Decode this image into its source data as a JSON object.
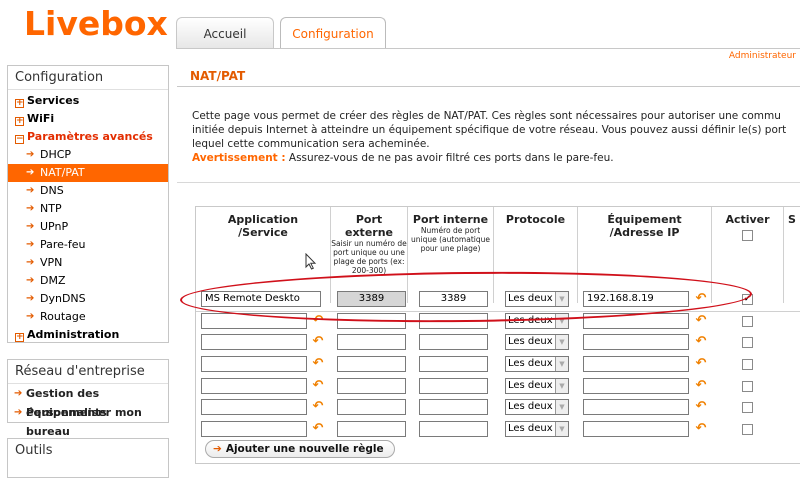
{
  "brand": {
    "logo": "Livebox"
  },
  "header": {
    "tabs": [
      {
        "label": "Accueil"
      },
      {
        "label": "Configuration"
      }
    ],
    "user_link": "Administrateur"
  },
  "sidebar": {
    "config_title": "Configuration",
    "items": [
      {
        "label": "Services"
      },
      {
        "label": "WiFi"
      },
      {
        "label": "Paramètres avancés"
      },
      {
        "label": "DHCP"
      },
      {
        "label": "NAT/PAT"
      },
      {
        "label": "DNS"
      },
      {
        "label": "NTP"
      },
      {
        "label": "UPnP"
      },
      {
        "label": "Pare-feu"
      },
      {
        "label": "VPN"
      },
      {
        "label": "DMZ"
      },
      {
        "label": "DynDNS"
      },
      {
        "label": "Routage"
      },
      {
        "label": "Administration"
      }
    ],
    "network_title": "Réseau d'entreprise",
    "network_items": [
      {
        "label": "Gestion des équipements"
      },
      {
        "label": "Personnaliser mon bureau"
      }
    ],
    "tools_title": "Outils"
  },
  "main": {
    "title": "NAT/PAT",
    "desc_line1": "Cette page vous permet de créer des règles de NAT/PAT. Ces règles sont nécessaires pour autoriser une commu",
    "desc_line2": "initiée depuis Internet à atteindre un équipement spécifique de votre réseau. Vous pouvez aussi définir le(s) port",
    "desc_line3": "lequel cette communication sera acheminée.",
    "warning_label": "Avertissement :",
    "warning_text": " Assurez-vous de ne pas avoir filtré ces ports dans le pare-feu."
  },
  "table": {
    "headers": {
      "app_line1": "Application",
      "app_line2": "/Service",
      "ext_line1": "Port",
      "ext_line2": "externe",
      "ext_hint": "Saisir un numéro de port unique ou une plage de ports (ex: 200-300)",
      "int_line1": "Port interne",
      "int_hint": "Numéro de port unique (automatique pour une plage)",
      "proto": "Protocole",
      "dev_line1": "Équipement",
      "dev_line2": "/Adresse IP",
      "act": "Activer",
      "s": "S"
    },
    "rows": [
      {
        "app": "MS Remote Deskto",
        "ext": "3389",
        "int": "3389",
        "proto": "Les deux",
        "ip": "192.168.8.19",
        "checked": true
      },
      {
        "app": "",
        "ext": "",
        "int": "",
        "proto": "Les deux",
        "ip": "",
        "checked": false
      },
      {
        "app": "",
        "ext": "",
        "int": "",
        "proto": "Les deux",
        "ip": "",
        "checked": false
      },
      {
        "app": "",
        "ext": "",
        "int": "",
        "proto": "Les deux",
        "ip": "",
        "checked": false
      },
      {
        "app": "",
        "ext": "",
        "int": "",
        "proto": "Les deux",
        "ip": "",
        "checked": false
      },
      {
        "app": "",
        "ext": "",
        "int": "",
        "proto": "Les deux",
        "ip": "",
        "checked": false
      },
      {
        "app": "",
        "ext": "",
        "int": "",
        "proto": "Les deux",
        "ip": "",
        "checked": false
      }
    ],
    "add_button": "Ajouter une nouvelle règle"
  },
  "colors": {
    "brand_orange": "#ff6600",
    "highlight_red": "#d0101a"
  }
}
